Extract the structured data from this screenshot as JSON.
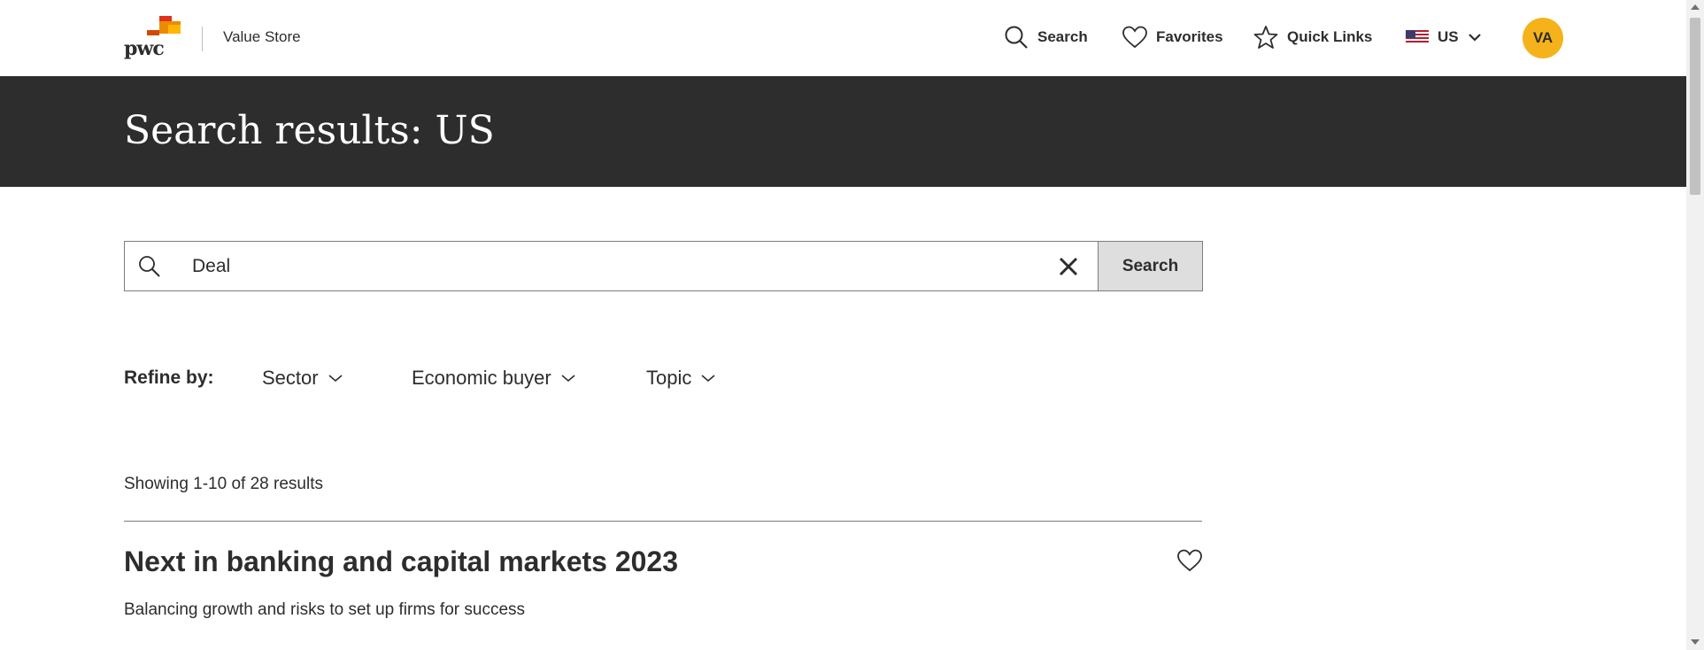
{
  "header": {
    "logo_text": "pwc",
    "brand_name": "Value Store",
    "nav": {
      "search_label": "Search",
      "favorites_label": "Favorites",
      "quick_links_label": "Quick Links",
      "region_label": "US"
    },
    "avatar_initials": "VA"
  },
  "banner": {
    "title": "Search results: US"
  },
  "search": {
    "value": "Deal",
    "button_label": "Search"
  },
  "refine": {
    "label": "Refine by:",
    "filters": [
      {
        "label": "Sector"
      },
      {
        "label": "Economic buyer"
      },
      {
        "label": "Topic"
      }
    ]
  },
  "results": {
    "count_text": "Showing 1-10 of 28 results",
    "items": [
      {
        "title": "Next in banking and capital markets 2023",
        "description": "Balancing growth and risks to set up firms for success"
      }
    ]
  },
  "colors": {
    "banner_bg": "#2d2d2d",
    "avatar_bg": "#f5b21a",
    "search_button_bg": "#dedede",
    "text": "#2d2d2d"
  }
}
